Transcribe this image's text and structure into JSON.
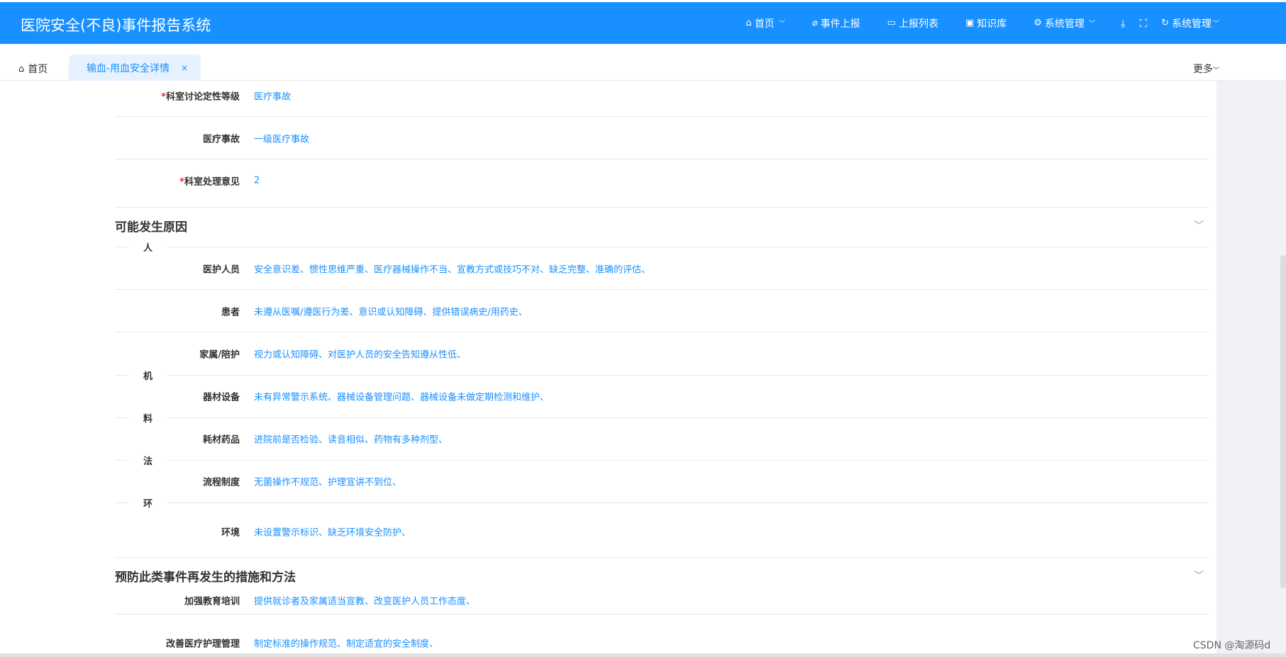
{
  "header": {
    "title": "医院安全(不良)事件报告系统",
    "nav": [
      {
        "label": "首页",
        "icon": "home-icon"
      },
      {
        "label": "事件上报",
        "icon": "paperclip-icon"
      },
      {
        "label": "上报列表",
        "icon": "monitor-icon"
      },
      {
        "label": "知识库",
        "icon": "book-icon"
      },
      {
        "label": "系统管理",
        "icon": "gear-icon"
      }
    ],
    "user_menu": "系统管理"
  },
  "tabs": {
    "home": "首页",
    "active": "输血-用血安全详情",
    "more": "更多"
  },
  "fields_top": [
    {
      "label": "科室讨论定性等级",
      "required": "*",
      "value": "医疗事故"
    },
    {
      "label": "医疗事故",
      "required": "",
      "value": "一级医疗事故"
    },
    {
      "label": "科室处理意见",
      "required": "*",
      "value": "2"
    }
  ],
  "section1": {
    "title": "可能发生原因",
    "categories": [
      "人",
      "机",
      "料",
      "法",
      "环"
    ],
    "rows": [
      {
        "label": "医护人员",
        "value": "安全意识差、惯性思维严重、医疗器械操作不当、宣教方式或技巧不对、缺乏完整、准确的评估、"
      },
      {
        "label": "患者",
        "value": "未遵从医嘱/遵医行为差、意识或认知障碍、提供错误病史/用药史、"
      },
      {
        "label": "家属/陪护",
        "value": "视力或认知障碍、对医护人员的安全告知遵从性低、"
      },
      {
        "label": "器材设备",
        "value": "未有异常警示系统、器械设备管理问题、器械设备未做定期检测和维护、"
      },
      {
        "label": "耗材药品",
        "value": "进院前是否检验、读音相似、药物有多种剂型、"
      },
      {
        "label": "流程制度",
        "value": "无菌操作不规范、护理宣讲不到位、"
      },
      {
        "label": "环境",
        "value": "未设置警示标识、缺乏环境安全防护、"
      }
    ]
  },
  "section2": {
    "title": "预防此类事件再发生的措施和方法",
    "rows": [
      {
        "label": "加强教育培训",
        "value": "提供就诊者及家属适当宣教、改变医护人员工作态度、"
      },
      {
        "label": "改善医疗护理管理",
        "value": "制定标准的操作规范、制定适宜的安全制度、"
      }
    ]
  },
  "watermark": "CSDN @淘源码d"
}
